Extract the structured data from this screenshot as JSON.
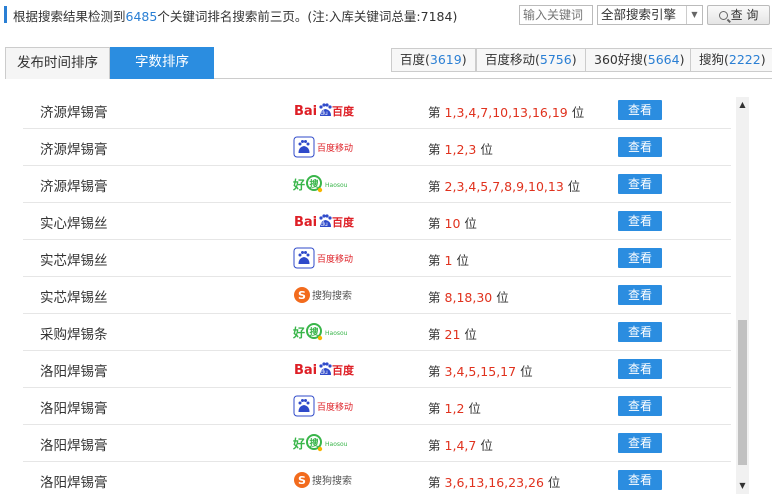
{
  "header": {
    "summary_prefix": "根据搜索结果检测到",
    "keyword_count": "6485",
    "summary_suffix": "个关键词排名搜索前三页。(注:入库关键词总量:7184)",
    "search_placeholder": "输入关键词",
    "engine_select_value": "全部搜索引擎",
    "query_label": "查 询"
  },
  "tabs": {
    "publish_time": "发布时间排序",
    "word_count": "字数排序"
  },
  "engine_tabs": [
    {
      "label": "百度",
      "count": "3619"
    },
    {
      "label": "百度移动",
      "count": "5756"
    },
    {
      "label": "360好搜",
      "count": "5664"
    },
    {
      "label": "搜狗",
      "count": "2222"
    }
  ],
  "rank_prefix": "第",
  "rank_suffix": "位",
  "view_label": "查看",
  "logos": {
    "baidu": "Bai百度",
    "baidu_mobile": "百度移动",
    "haosou": "好搜",
    "haosou_sub": "Haosou",
    "sogou": "搜狗搜索"
  },
  "rows": [
    {
      "keyword": "济源焊锡膏",
      "engine": "baidu",
      "positions": "1,3,4,7,10,13,16,19"
    },
    {
      "keyword": "济源焊锡膏",
      "engine": "baidu_mobile",
      "positions": "1,2,3"
    },
    {
      "keyword": "济源焊锡膏",
      "engine": "haosou",
      "positions": "2,3,4,5,7,8,9,10,13"
    },
    {
      "keyword": "实心焊锡丝",
      "engine": "baidu",
      "positions": "10"
    },
    {
      "keyword": "实芯焊锡丝",
      "engine": "baidu_mobile",
      "positions": "1"
    },
    {
      "keyword": "实芯焊锡丝",
      "engine": "sogou",
      "positions": "8,18,30"
    },
    {
      "keyword": "采购焊锡条",
      "engine": "haosou",
      "positions": "21"
    },
    {
      "keyword": "洛阳焊锡膏",
      "engine": "baidu",
      "positions": "3,4,5,15,17"
    },
    {
      "keyword": "洛阳焊锡膏",
      "engine": "baidu_mobile",
      "positions": "1,2"
    },
    {
      "keyword": "洛阳焊锡膏",
      "engine": "haosou",
      "positions": "1,4,7"
    },
    {
      "keyword": "洛阳焊锡膏",
      "engine": "sogou",
      "positions": "3,6,13,16,23,26"
    }
  ],
  "colors": {
    "accent": "#2b8de0",
    "count": "#2a7fd4",
    "rank": "#e0321e"
  }
}
